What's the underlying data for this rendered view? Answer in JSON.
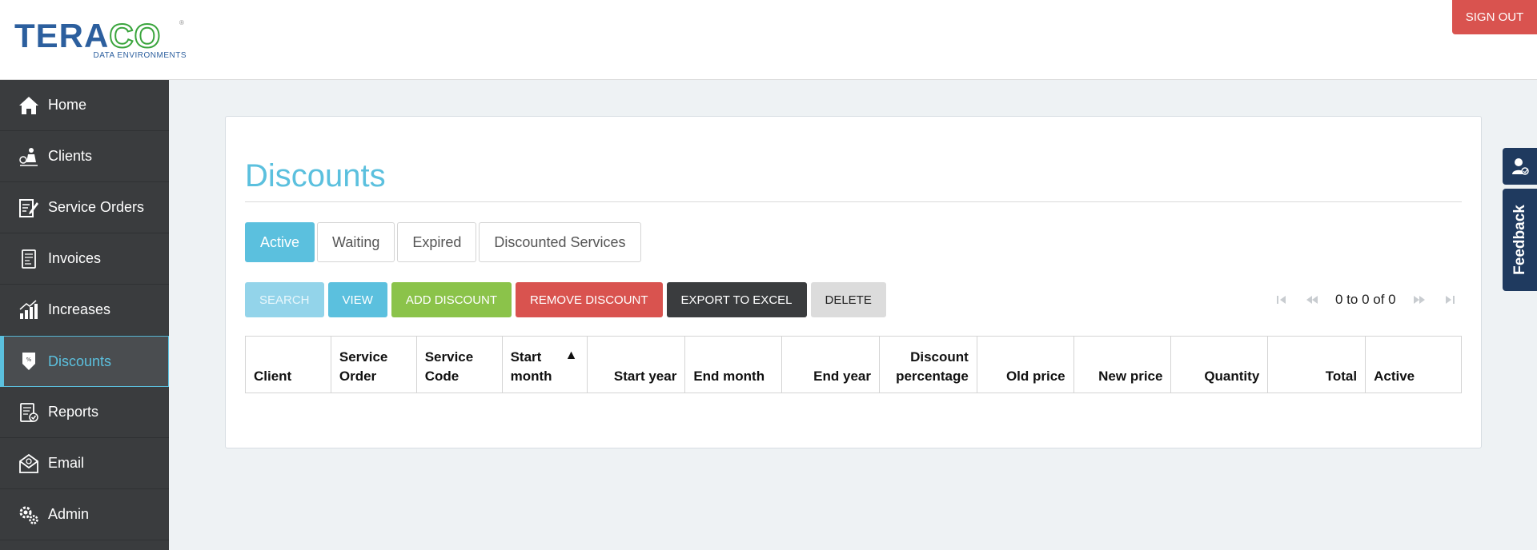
{
  "header": {
    "logo_word_tera": "TERA",
    "logo_word_co": "CO",
    "logo_reg": "®",
    "logo_sub": "DATA ENVIRONMENTS",
    "signout_label": "SIGN OUT",
    "signout_color": "#d9534f"
  },
  "sidebar": {
    "items": [
      {
        "label": "Home",
        "icon": "home-icon"
      },
      {
        "label": "Clients",
        "icon": "clients-icon"
      },
      {
        "label": "Service Orders",
        "icon": "service-orders-icon"
      },
      {
        "label": "Invoices",
        "icon": "invoice-icon"
      },
      {
        "label": "Increases",
        "icon": "increase-chart-icon"
      },
      {
        "label": "Discounts",
        "icon": "discount-tag-icon",
        "active": true
      },
      {
        "label": "Reports",
        "icon": "report-icon"
      },
      {
        "label": "Email",
        "icon": "email-icon"
      },
      {
        "label": "Admin",
        "icon": "gear-icon"
      }
    ],
    "background": "#3a3c3e",
    "active_color": "#5bc0de"
  },
  "main": {
    "title": "Discounts",
    "tabs": [
      {
        "label": "Active",
        "active": true
      },
      {
        "label": "Waiting"
      },
      {
        "label": "Expired"
      },
      {
        "label": "Discounted Services"
      }
    ],
    "toolbar": {
      "search": "SEARCH",
      "view": "VIEW",
      "add": "ADD DISCOUNT",
      "remove": "REMOVE DISCOUNT",
      "export": "EXPORT TO EXCEL",
      "delete": "DELETE"
    },
    "pager": {
      "text": "0 to 0 of 0",
      "icons": [
        "first-page-icon",
        "previous-page-icon",
        "next-page-icon",
        "last-page-icon"
      ]
    },
    "table": {
      "columns": [
        {
          "label": "Client"
        },
        {
          "label": "Service Order"
        },
        {
          "label": "Service Code"
        },
        {
          "label": "Start month",
          "sort": "▲"
        },
        {
          "label": "Start year"
        },
        {
          "label": "End month"
        },
        {
          "label": "End year"
        },
        {
          "label": "Discount percentage"
        },
        {
          "label": "Old price"
        },
        {
          "label": "New price"
        },
        {
          "label": "Quantity"
        },
        {
          "label": "Total"
        },
        {
          "label": "Active"
        }
      ],
      "rows": []
    }
  },
  "feedback": {
    "label": "Feedback",
    "icon": "user-feedback-icon"
  }
}
